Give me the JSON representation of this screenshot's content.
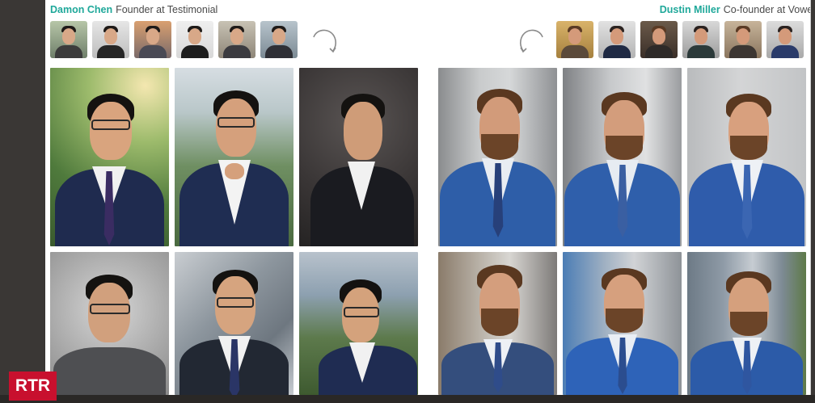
{
  "left_person": {
    "name": "Damon Chen",
    "role": "Founder at Testimonial"
  },
  "right_person": {
    "name": "Dustin Miller",
    "role": "Co-founder at Vowel"
  },
  "left_thumbnails_count": 6,
  "right_thumbnails_count": 6,
  "watermark": "RTR",
  "colors": {
    "name_accent": "#1fa89a",
    "watermark_bg": "#c8102e"
  }
}
